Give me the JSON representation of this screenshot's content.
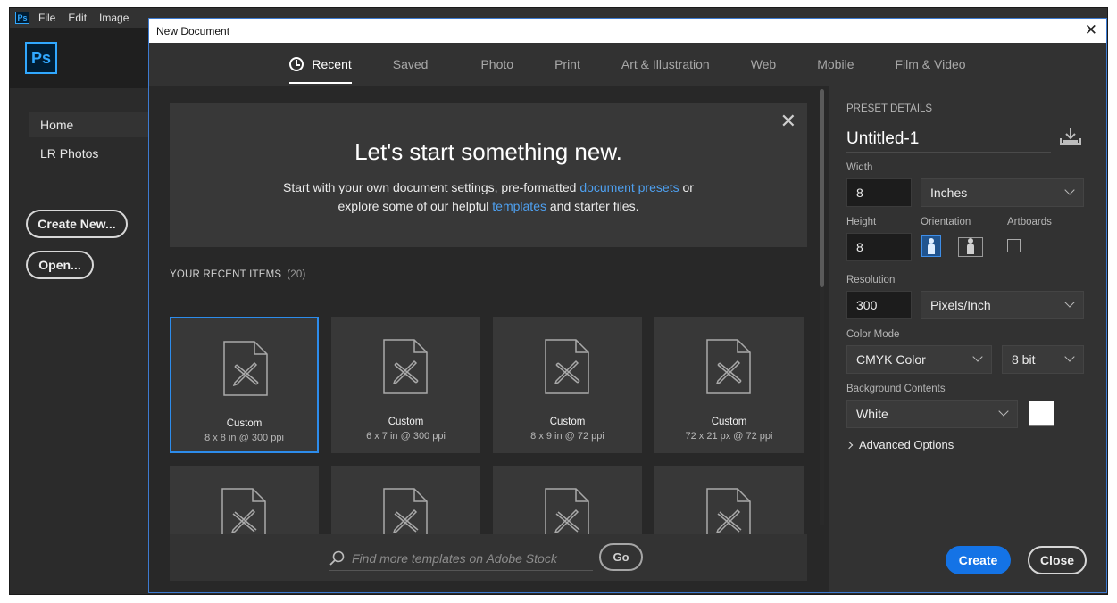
{
  "menubar": {
    "app_icon": "Ps",
    "items": [
      "File",
      "Edit",
      "Image"
    ]
  },
  "left_panel": {
    "logo": "Ps",
    "nav": [
      "Home",
      "LR Photos"
    ],
    "create_new": "Create New...",
    "open": "Open..."
  },
  "dialog": {
    "title": "New Document",
    "close_glyph": "✕",
    "tabs": [
      "Recent",
      "Saved",
      "Photo",
      "Print",
      "Art & Illustration",
      "Web",
      "Mobile",
      "Film & Video"
    ],
    "hero": {
      "heading": "Let's start something new.",
      "line1_pre": "Start with your own document settings, pre-formatted ",
      "line1_link": "document presets",
      "line1_post": " or",
      "line2_pre": "explore some of our helpful ",
      "line2_link": "templates",
      "line2_post": " and starter files.",
      "close_glyph": "✕"
    },
    "recent": {
      "heading": "YOUR RECENT ITEMS",
      "count": "(20)",
      "items": [
        {
          "name": "Custom",
          "dims": "8 x 8 in @ 300 ppi"
        },
        {
          "name": "Custom",
          "dims": "6 x 7 in @ 300 ppi"
        },
        {
          "name": "Custom",
          "dims": "8 x 9 in @ 72 ppi"
        },
        {
          "name": "Custom",
          "dims": "72 x 21 px @ 72 ppi"
        }
      ]
    },
    "stock": {
      "placeholder": "Find more templates on Adobe Stock",
      "go": "Go"
    },
    "preset": {
      "section_label": "PRESET DETAILS",
      "name": "Untitled-1",
      "width_label": "Width",
      "width_value": "8",
      "width_unit": "Inches",
      "height_label": "Height",
      "height_value": "8",
      "orientation_label": "Orientation",
      "artboards_label": "Artboards",
      "resolution_label": "Resolution",
      "resolution_value": "300",
      "resolution_unit": "Pixels/Inch",
      "color_mode_label": "Color Mode",
      "color_mode": "CMYK Color",
      "bit_depth": "8 bit",
      "background_label": "Background Contents",
      "background": "White",
      "advanced": "Advanced Options",
      "create": "Create",
      "close": "Close"
    }
  },
  "colors": {
    "accent": "#1473e6",
    "link": "#4ea0f0",
    "selection": "#2d8ceb",
    "background_swatch": "#ffffff"
  },
  "icons": [
    "clock-icon",
    "close-icon",
    "document-icon",
    "search-icon",
    "save-preset-icon",
    "portrait-icon",
    "landscape-icon",
    "chevron-down-icon",
    "chevron-right-icon"
  ]
}
